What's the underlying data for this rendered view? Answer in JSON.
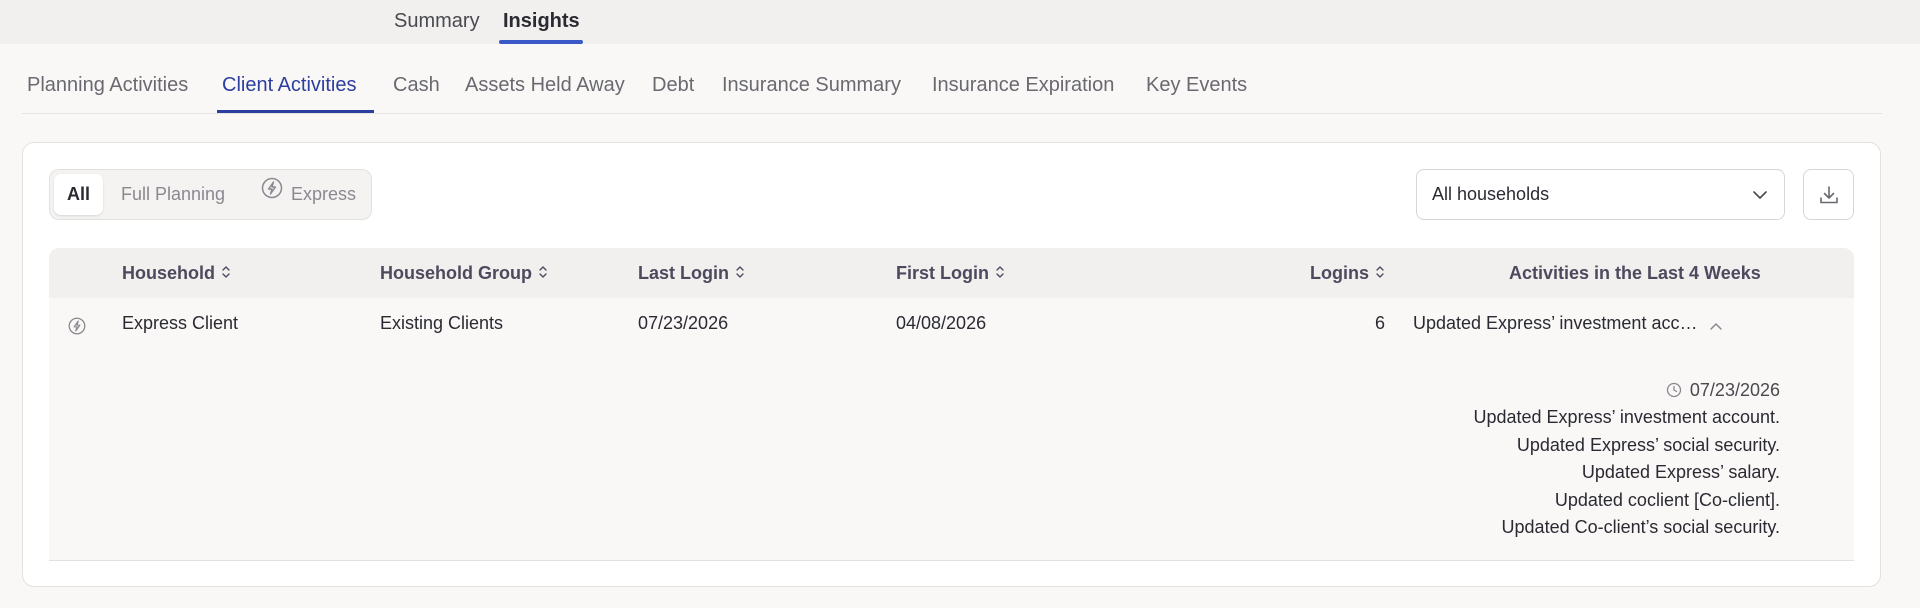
{
  "top_tabs": [
    {
      "label": "Summary",
      "active": false
    },
    {
      "label": "Insights",
      "active": true
    }
  ],
  "sub_tabs": [
    {
      "label": "Planning Activities",
      "active": false
    },
    {
      "label": "Client Activities",
      "active": true
    },
    {
      "label": "Cash",
      "active": false
    },
    {
      "label": "Assets Held Away",
      "active": false
    },
    {
      "label": "Debt",
      "active": false
    },
    {
      "label": "Insurance Summary",
      "active": false
    },
    {
      "label": "Insurance Expiration",
      "active": false
    },
    {
      "label": "Key Events",
      "active": false
    }
  ],
  "filter": {
    "options": [
      {
        "label": "All",
        "active": true
      },
      {
        "label": "Full Planning",
        "active": false
      },
      {
        "label": "Express",
        "active": false,
        "icon": "lightning-bolt-icon"
      }
    ]
  },
  "household_select": {
    "value": "All households",
    "icon": "chevron-down-icon"
  },
  "download_button": {
    "icon": "download-icon"
  },
  "table": {
    "columns": [
      "Household",
      "Household Group",
      "Last Login",
      "First Login",
      "Logins",
      "Activities in the Last 4 Weeks"
    ],
    "rows": [
      {
        "type_icon": "lightning-bolt-icon",
        "household": "Express Client",
        "group": "Existing Clients",
        "last_login": "07/23/2026",
        "first_login": "04/08/2026",
        "logins": "6",
        "activity_summary": "Updated Express’ investment account.",
        "expanded": true,
        "activity_detail": {
          "date": "07/23/2026",
          "items": [
            "Updated Express’ investment account.",
            "Updated Express’ social security.",
            "Updated Express’ salary.",
            "Updated coclient [Co-client].",
            "Updated Co-client’s social security."
          ]
        }
      }
    ]
  },
  "colors": {
    "accent": "#2c3f9e",
    "top_underline": "#3a58c6",
    "header_bg": "#f1f0ee"
  }
}
